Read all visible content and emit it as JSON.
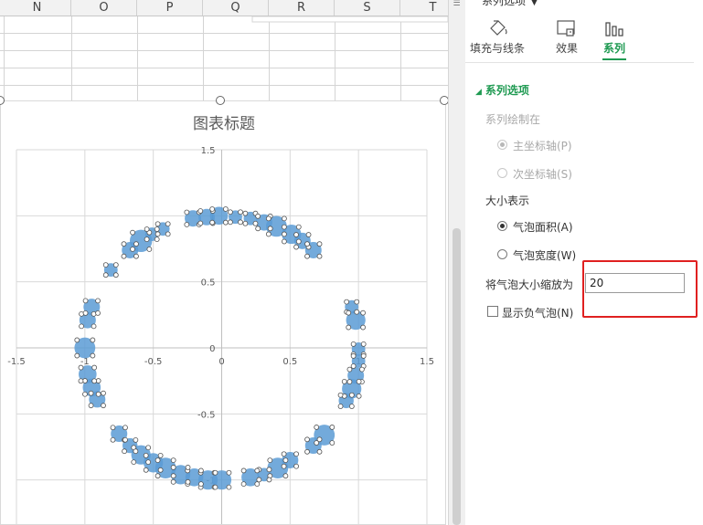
{
  "spreadsheet": {
    "columns": [
      "N",
      "O",
      "P",
      "Q",
      "R",
      "S",
      "T"
    ]
  },
  "chart": {
    "title": "图表标题"
  },
  "chart_data": {
    "type": "scatter",
    "title": "图表标题",
    "xlabel": "",
    "ylabel": "",
    "xlim": [
      -1.5,
      1.5
    ],
    "ylim": [
      -1.5,
      1.5
    ],
    "x_ticks": [
      "-1.5",
      "-1",
      "-0.5",
      "0",
      "0.5",
      "1",
      "1.5"
    ],
    "y_ticks": [
      "1.5",
      "1",
      "0.5",
      "0",
      "-0.5",
      "-1"
    ],
    "grid": true,
    "bubble_color": "#5b9bd5",
    "points": [
      {
        "x": -0.81,
        "y": 0.59,
        "size": 0.3
      },
      {
        "x": -0.67,
        "y": 0.74,
        "size": 0.5
      },
      {
        "x": -0.59,
        "y": 0.81,
        "size": 0.9
      },
      {
        "x": -0.51,
        "y": 0.86,
        "size": 0.3
      },
      {
        "x": -0.43,
        "y": 0.9,
        "size": 0.3
      },
      {
        "x": -0.21,
        "y": 0.98,
        "size": 0.5
      },
      {
        "x": -0.11,
        "y": 0.99,
        "size": 0.5
      },
      {
        "x": -0.02,
        "y": 1.0,
        "size": 0.6
      },
      {
        "x": 0.1,
        "y": 0.99,
        "size": 0.3
      },
      {
        "x": 0.21,
        "y": 0.98,
        "size": 0.3
      },
      {
        "x": 0.31,
        "y": 0.95,
        "size": 0.5
      },
      {
        "x": 0.4,
        "y": 0.92,
        "size": 0.8
      },
      {
        "x": 0.51,
        "y": 0.86,
        "size": 0.7
      },
      {
        "x": 0.59,
        "y": 0.81,
        "size": 0.5
      },
      {
        "x": 0.67,
        "y": 0.74,
        "size": 0.5
      },
      {
        "x": 0.95,
        "y": 0.31,
        "size": 0.3
      },
      {
        "x": 0.98,
        "y": 0.21,
        "size": 0.7
      },
      {
        "x": 1.0,
        "y": -0.01,
        "size": 0.3
      },
      {
        "x": 1.0,
        "y": -0.1,
        "size": 0.3
      },
      {
        "x": 0.98,
        "y": -0.21,
        "size": 0.5
      },
      {
        "x": 0.95,
        "y": -0.31,
        "size": 0.7
      },
      {
        "x": 0.91,
        "y": -0.4,
        "size": 0.4
      },
      {
        "x": 0.75,
        "y": -0.66,
        "size": 0.8
      },
      {
        "x": 0.67,
        "y": -0.74,
        "size": 0.5
      },
      {
        "x": 0.5,
        "y": -0.85,
        "size": 0.5
      },
      {
        "x": 0.41,
        "y": -0.91,
        "size": 0.8
      },
      {
        "x": 0.31,
        "y": -0.96,
        "size": 0.3
      },
      {
        "x": 0.21,
        "y": -0.98,
        "size": 0.6
      },
      {
        "x": 0.0,
        "y": -1.0,
        "size": 0.7
      },
      {
        "x": -0.1,
        "y": -1.0,
        "size": 0.7
      },
      {
        "x": -0.2,
        "y": -0.98,
        "size": 0.6
      },
      {
        "x": -0.3,
        "y": -0.96,
        "size": 0.7
      },
      {
        "x": -0.41,
        "y": -0.91,
        "size": 0.8
      },
      {
        "x": -0.5,
        "y": -0.87,
        "size": 0.7
      },
      {
        "x": -0.59,
        "y": -0.81,
        "size": 0.7
      },
      {
        "x": -0.67,
        "y": -0.74,
        "size": 0.4
      },
      {
        "x": -0.75,
        "y": -0.65,
        "size": 0.5
      },
      {
        "x": -0.91,
        "y": -0.39,
        "size": 0.5
      },
      {
        "x": -0.95,
        "y": -0.3,
        "size": 0.6
      },
      {
        "x": -0.98,
        "y": -0.2,
        "size": 0.6
      },
      {
        "x": -1.0,
        "y": 0.0,
        "size": 0.8
      },
      {
        "x": -0.98,
        "y": 0.21,
        "size": 0.5
      },
      {
        "x": -0.95,
        "y": 0.31,
        "size": 0.5
      }
    ]
  },
  "pane": {
    "header_title": "系列选项",
    "tabs": [
      {
        "label": "填充与线条",
        "icon": "fill-bucket-icon"
      },
      {
        "label": "效果",
        "icon": "effects-icon"
      },
      {
        "label": "系列",
        "icon": "series-bars-icon"
      }
    ],
    "section_title": "系列选项",
    "plot_on_label": "系列绘制在",
    "primary_axis_label": "主坐标轴(P)",
    "secondary_axis_label": "次坐标轴(S)",
    "size_represents_label": "大小表示",
    "bubble_area_label": "气泡面积(A)",
    "bubble_width_label": "气泡宽度(W)",
    "scale_label": "将气泡大小缩放为",
    "scale_value": "20",
    "show_negative_label": "显示负气泡(N)",
    "accent_color": "#1f9a52",
    "highlight_color": "#e02020"
  }
}
